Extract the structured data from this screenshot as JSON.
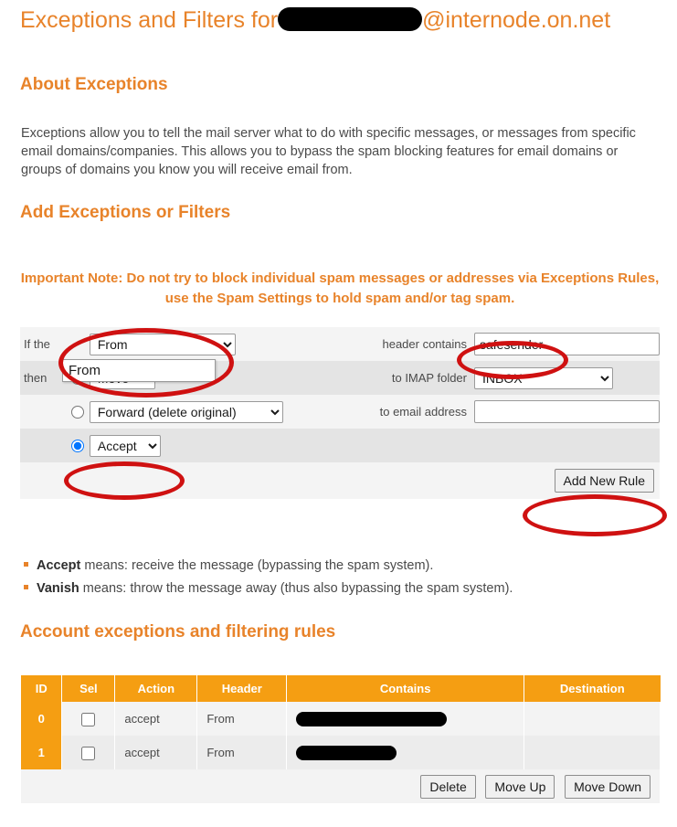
{
  "header": {
    "title_prefix": "Exceptions and Filters for",
    "redacted_account": "",
    "title_suffix": "@internode.on.net"
  },
  "about": {
    "heading": "About Exceptions",
    "paragraph": "Exceptions allow you to tell the mail server what to do with specific messages, or messages from specific email domains/companies. This allows you to bypass the spam blocking features for email domains or groups of domains you know you will receive email from."
  },
  "add_section": {
    "heading": "Add Exceptions or Filters",
    "important_note": "Important Note: Do not try to block individual spam messages or addresses via Exceptions Rules, use the Spam Settings to hold spam and/or tag spam."
  },
  "form": {
    "if_label": "If the",
    "then_label": "then",
    "header_select": {
      "value": "From",
      "options": [
        "From"
      ],
      "open_option": "From"
    },
    "header_contains_label": "header contains",
    "contains_input": {
      "value": "safesender",
      "placeholder": ""
    },
    "move_radio_selected": false,
    "move_select": {
      "value": "Move",
      "options": [
        "Move"
      ]
    },
    "imap_folder_label": "to IMAP folder",
    "imap_select": {
      "value": "INBOX",
      "options": [
        "INBOX"
      ]
    },
    "forward_radio_selected": false,
    "forward_select": {
      "value": "Forward (delete original)",
      "options": [
        "Forward (delete original)"
      ]
    },
    "email_address_label": "to email address",
    "email_input": {
      "value": "",
      "placeholder": ""
    },
    "accept_radio_selected": true,
    "accept_select": {
      "value": "Accept",
      "options": [
        "Accept"
      ]
    },
    "add_new_rule_label": "Add New Rule"
  },
  "bullets": [
    {
      "term": "Accept",
      "text": " means: receive the message (bypassing the spam system)."
    },
    {
      "term": "Vanish",
      "text": " means: throw the message away (thus also bypassing the spam system)."
    }
  ],
  "rules": {
    "heading": "Account exceptions and filtering rules",
    "columns": [
      "ID",
      "Sel",
      "Action",
      "Header",
      "Contains",
      "Destination"
    ],
    "rows": [
      {
        "id": "0",
        "selected": false,
        "action": "accept",
        "header": "From",
        "contains": "",
        "contains_redaction_width": 165,
        "destination": ""
      },
      {
        "id": "1",
        "selected": false,
        "action": "accept",
        "header": "From",
        "contains": "",
        "contains_redaction_width": 110,
        "destination": ""
      }
    ],
    "buttons": {
      "delete": "Delete",
      "move_up": "Move Up",
      "move_down": "Move Down"
    }
  },
  "colors": {
    "brand_orange": "#e8832a",
    "table_header_orange": "#f59e12",
    "annotation_red": "#cf1111",
    "body_text": "#4a4a4a"
  },
  "annotations": [
    {
      "name": "header-select-highlight"
    },
    {
      "name": "contains-input-highlight"
    },
    {
      "name": "accept-option-highlight"
    },
    {
      "name": "add-new-rule-highlight"
    }
  ]
}
